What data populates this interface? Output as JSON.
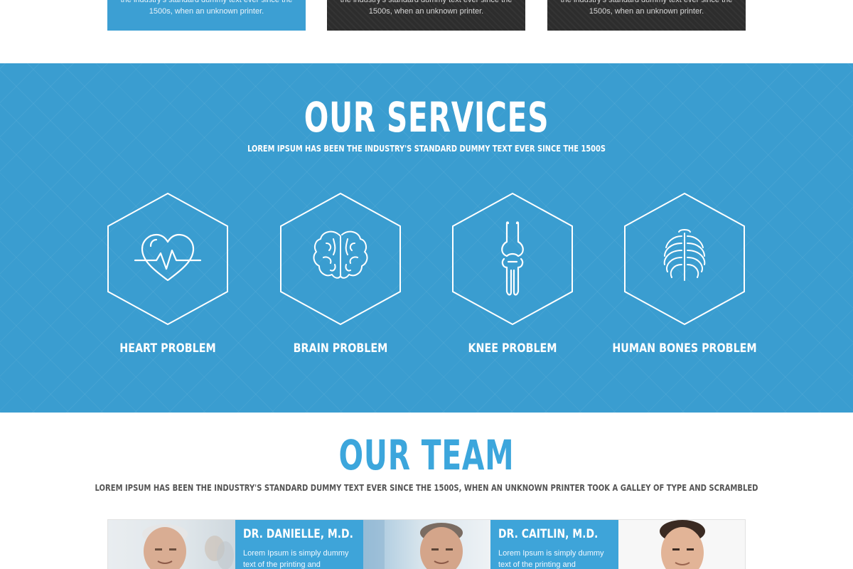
{
  "top_cards": [
    {
      "text_line1": "the industry's standard dummy text ever since the",
      "text_line2": "1500s, when an unknown printer."
    },
    {
      "text_line1": "the industry's standard dummy text ever since the",
      "text_line2": "1500s, when an unknown printer."
    },
    {
      "text_line1": "the industry's standard dummy text ever since the",
      "text_line2": "1500s, when an unknown printer."
    }
  ],
  "services": {
    "title": "OUR SERVICES",
    "subtitle": "LOREM IPSUM HAS BEEN THE INDUSTRY'S STANDARD DUMMY TEXT EVER SINCE THE 1500S",
    "items": [
      {
        "label": "HEART PROBLEM",
        "icon": "heart-icon"
      },
      {
        "label": "BRAIN PROBLEM",
        "icon": "brain-icon"
      },
      {
        "label": "KNEE PROBLEM",
        "icon": "knee-icon"
      },
      {
        "label": "HUMAN BONES PROBLEM",
        "icon": "ribcage-icon"
      }
    ]
  },
  "team": {
    "title": "OUR TEAM",
    "subtitle": "LOREM IPSUM HAS BEEN THE INDUSTRY'S STANDARD DUMMY TEXT EVER SINCE THE 1500S, WHEN AN UNKNOWN PRINTER TOOK A GALLEY OF TYPE AND SCRAMBLED",
    "members": [
      {
        "name": "DR. DANIELLE, M.D.",
        "desc_line1": "Lorem Ipsum is simply dummy",
        "desc_line2": "text of the printing and"
      },
      {
        "name": "DR. CAITLIN, M.D.",
        "desc_line1": "Lorem Ipsum is simply dummy",
        "desc_line2": "text of the printing and"
      }
    ]
  },
  "colors": {
    "accent": "#3a9dd0",
    "dark": "#2d2d2d",
    "title_blue": "#3ca6dc"
  }
}
